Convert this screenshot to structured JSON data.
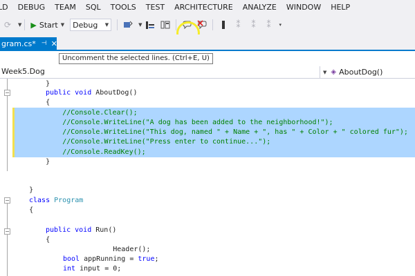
{
  "menu": [
    "LD",
    "DEBUG",
    "TEAM",
    "SQL",
    "TOOLS",
    "TEST",
    "ARCHITECTURE",
    "ANALYZE",
    "WINDOW",
    "HELP"
  ],
  "toolbar": {
    "start_label": "Start",
    "config_value": "Debug",
    "icons": [
      "redo-icon",
      "start-icon",
      "find-icon",
      "bookmark-icon",
      "comment-icon",
      "uncomment-icon",
      "indent-icon"
    ]
  },
  "tab": {
    "label": "gram.cs*",
    "pin": "⊣",
    "close": "✕"
  },
  "tooltip": "Uncomment the selected lines. (Ctrl+E, U)",
  "nav": {
    "left": "Week5.Dog",
    "right": "AboutDog()"
  },
  "code": {
    "l1": "        }",
    "l2_kw": "public void",
    "l2_rest": " AboutDog()",
    "l3": "        {",
    "l4": "            //Console.Clear();",
    "l5": "            //Console.WriteLine(\"A dog has been added to the neighborhood!\");",
    "l6": "            //Console.WriteLine(\"This dog, named \" + Name + \", has \" + Color + \" colored fur\");",
    "l7": "            //Console.WriteLine(\"Press enter to continue...\");",
    "l8": "            //Console.ReadKey();",
    "l9": "        }",
    "l12": "    }",
    "l13_kw": "class",
    "l13_ty": "Program",
    "l14": "    {",
    "l17_kw": "public void",
    "l17_rest": " Run()",
    "l18": "        {",
    "l19": "            Header();",
    "l20_kw": "bool",
    "l20_mid": " appRunning = ",
    "l20_kw2": "true",
    "l20_end": ";",
    "l21_kw": "int",
    "l21_rest": " input = 0;"
  }
}
